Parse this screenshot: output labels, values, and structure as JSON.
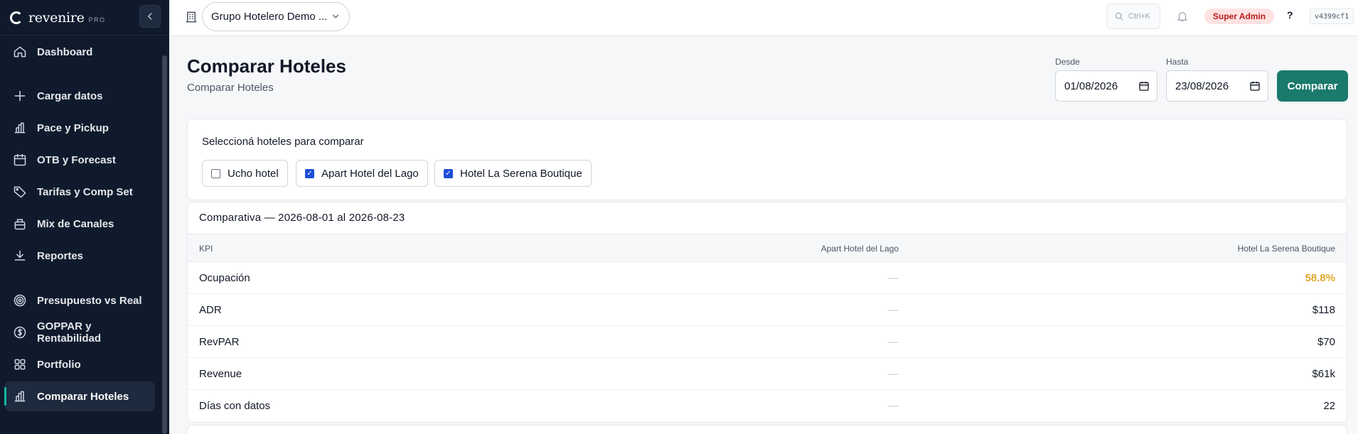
{
  "brand": {
    "name": "revenire",
    "tier": "PRO"
  },
  "sidebar": {
    "items": [
      {
        "label": "Dashboard",
        "icon": "home-icon"
      },
      {
        "label": "Cargar datos",
        "icon": "plus-icon"
      },
      {
        "label": "Pace y Pickup",
        "icon": "bar-chart-icon"
      },
      {
        "label": "OTB y Forecast",
        "icon": "calendar-icon"
      },
      {
        "label": "Tarifas y Comp Set",
        "icon": "tag-icon"
      },
      {
        "label": "Mix de Canales",
        "icon": "briefcase-icon"
      },
      {
        "label": "Reportes",
        "icon": "download-icon"
      },
      {
        "label": "Presupuesto vs Real",
        "icon": "target-icon"
      },
      {
        "label": "GOPPAR y Rentabilidad",
        "icon": "dollar-icon"
      },
      {
        "label": "Portfolio",
        "icon": "grid-icon"
      },
      {
        "label": "Comparar Hoteles",
        "icon": "bar-chart-icon",
        "active": true
      }
    ]
  },
  "topbar": {
    "org": "Grupo Hotelero Demo ...",
    "search_shortcut": "Ctrl+K",
    "role": "Super Admin",
    "help": "?",
    "version": "v4399cf1"
  },
  "page": {
    "title": "Comparar Hoteles",
    "subtitle": "Comparar Hoteles"
  },
  "filters": {
    "from_label": "Desde",
    "from_value": "01/08/2026",
    "to_label": "Hasta",
    "to_value": "23/08/2026",
    "compare_label": "Comparar"
  },
  "hotel_select": {
    "title": "Seleccioná hoteles para comparar",
    "hotels": [
      {
        "name": "Ucho hotel",
        "checked": false
      },
      {
        "name": "Apart Hotel del Lago",
        "checked": true
      },
      {
        "name": "Hotel La Serena Boutique",
        "checked": true
      }
    ]
  },
  "comparison": {
    "title": "Comparativa — 2026-08-01 al 2026-08-23",
    "headers": [
      "KPI",
      "Apart Hotel del Lago",
      "Hotel La Serena Boutique"
    ],
    "rows": [
      {
        "kpi": "Ocupación",
        "a": "—",
        "b": "58.8%",
        "highlight": true
      },
      {
        "kpi": "ADR",
        "a": "—",
        "b": "$118"
      },
      {
        "kpi": "RevPAR",
        "a": "—",
        "b": "$70"
      },
      {
        "kpi": "Revenue",
        "a": "—",
        "b": "$61k"
      },
      {
        "kpi": "Días con datos",
        "a": "—",
        "b": "22"
      }
    ]
  },
  "colors": {
    "sidebar_bg": "#0f1b2d",
    "accent": "#1a7a6c",
    "highlight": "#e0a82e",
    "role_badge": "#b91c1c"
  }
}
